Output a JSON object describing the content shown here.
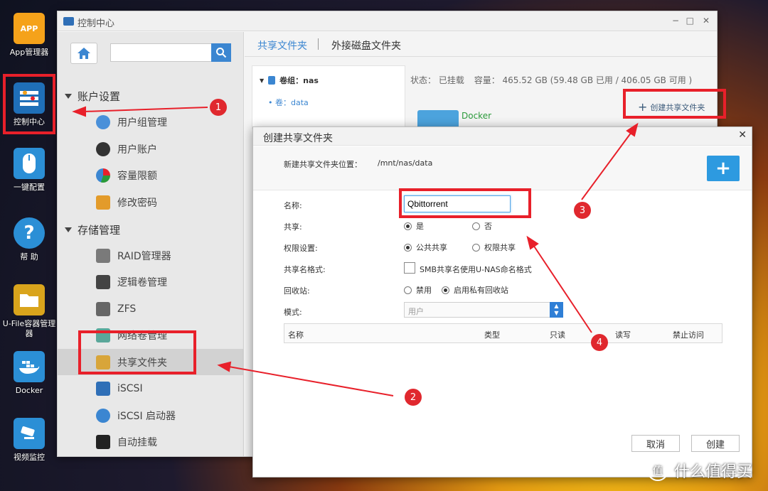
{
  "desktop": {
    "items": [
      {
        "label": "App管理器",
        "glyph": "APP"
      },
      {
        "label": "控制中心",
        "glyph": ""
      },
      {
        "label": "一键配置",
        "glyph": ""
      },
      {
        "label": "帮 助",
        "glyph": "?"
      },
      {
        "label": "U-File容器管理器",
        "glyph": ""
      },
      {
        "label": "Docker",
        "glyph": ""
      },
      {
        "label": "视频监控",
        "glyph": ""
      }
    ]
  },
  "window": {
    "title": "控制中心",
    "controls": {
      "min": "−",
      "max": "□",
      "close": "✕"
    }
  },
  "sidebar": {
    "account_section": "账户设置",
    "account_items": [
      "用户组管理",
      "用户账户",
      "容量限额",
      "修改密码"
    ],
    "storage_section": "存储管理",
    "storage_items": [
      "RAID管理器",
      "逻辑卷管理",
      "ZFS",
      "网络卷管理",
      "共享文件夹",
      "iSCSI",
      "iSCSI 启动器",
      "自动挂载"
    ]
  },
  "main": {
    "tabs": [
      "共享文件夹",
      "外接磁盘文件夹"
    ],
    "volume_group": "卷组：nas",
    "volume": "卷：data",
    "status_label": "状态：",
    "status_value": "已挂载",
    "capacity_label": "容量：",
    "capacity_value": "465.52 GB (59.48 GB 已用 / 406.05 GB 可用 )",
    "create_button": "创建共享文件夹",
    "folder_name": "Docker"
  },
  "dialog": {
    "title": "创建共享文件夹",
    "location_label": "新建共享文件夹位置：",
    "location_value": "/mnt/nas/data",
    "name_label": "名称:",
    "name_value": "Qbittorrent",
    "share_label": "共享:",
    "share_yes": "是",
    "share_no": "否",
    "perm_label": "权限设置:",
    "perm_public": "公共共享",
    "perm_restricted": "权限共享",
    "naming_label": "共享名格式:",
    "naming_option": "SMB共享名使用U-NAS命名格式",
    "recycle_label": "回收站:",
    "recycle_off": "禁用",
    "recycle_on": "启用私有回收站",
    "mode_label": "模式:",
    "mode_value": "用户",
    "table_headers": [
      "名称",
      "类型",
      "只读",
      "读写",
      "禁止访问"
    ],
    "cancel": "取消",
    "create": "创建"
  },
  "annotations": [
    "1",
    "2",
    "3",
    "4"
  ],
  "watermark": "什么值得买",
  "colors": {
    "accent": "#3b86d1",
    "highlight": "#e8202a",
    "badge": "#e0282e"
  }
}
